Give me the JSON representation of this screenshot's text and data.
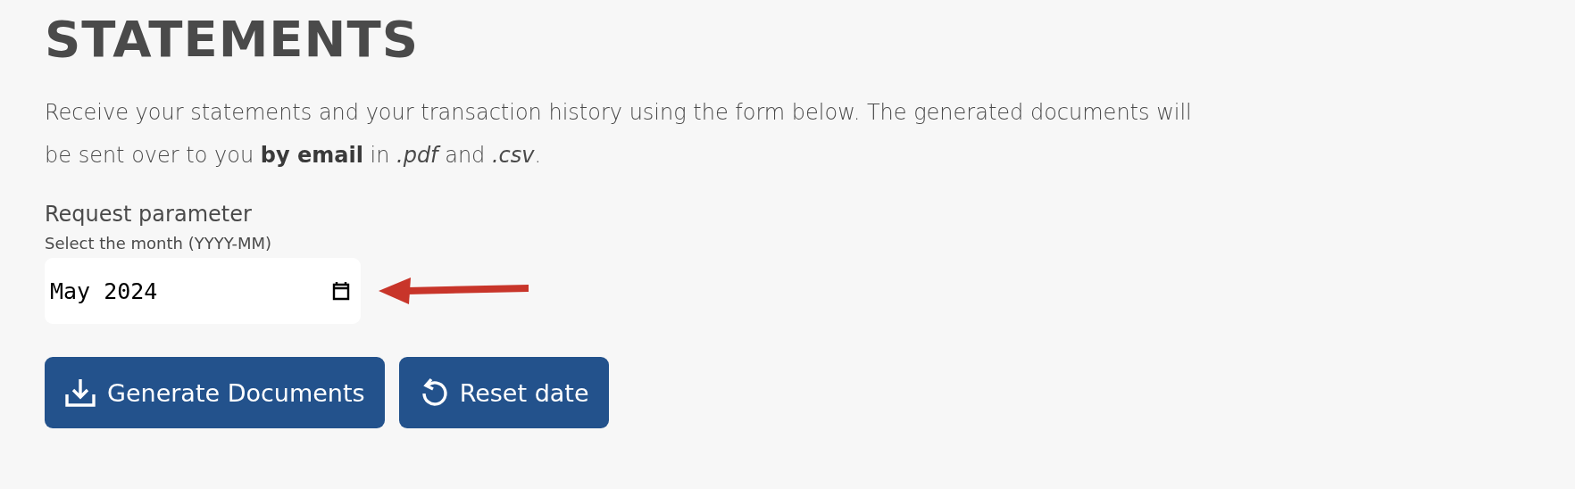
{
  "title": "STATEMENTS",
  "description": "Receive your statements and your transaction history using the form below. The generated documents will be sent over to you **by email** in *.pdf* and *.csv*.",
  "form": {
    "label": "Request parameter",
    "hint": "Select the month (YYYY-MM)",
    "value": "May 2024"
  },
  "buttons": [
    {
      "kind": "download",
      "label": "Generate Documents"
    },
    {
      "kind": "reset",
      "label": "Reset date"
    }
  ]
}
